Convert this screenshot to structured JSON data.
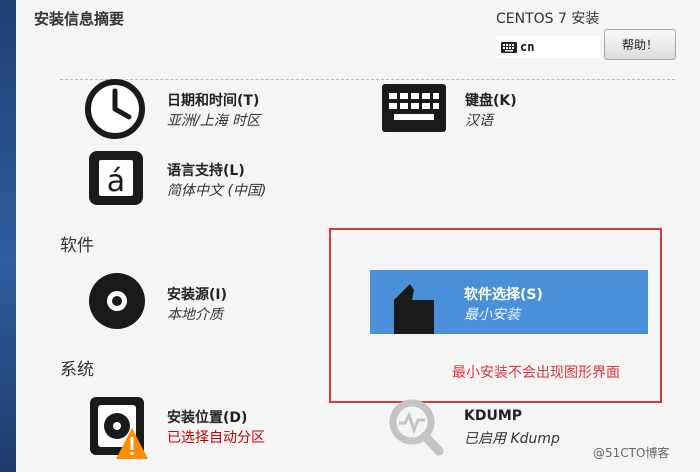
{
  "header": {
    "title": "安装信息摘要",
    "product": "CENTOS 7 安装",
    "keyboard_layout": "cn",
    "help_label": "帮助！"
  },
  "sections": {
    "software": "软件",
    "system": "系统"
  },
  "spokes": {
    "datetime": {
      "name": "日期和时间(T)",
      "status": "亚洲/上海 时区",
      "icon": "clock-icon"
    },
    "keyboard": {
      "name": "键盘(K)",
      "status": "汉语",
      "icon": "keyboard-icon"
    },
    "language": {
      "name": "语言支持(L)",
      "status": "简体中文 (中国)",
      "icon": "language-icon",
      "glyph": "á"
    },
    "source": {
      "name": "安装源(I)",
      "status": "本地介质",
      "icon": "disc-icon"
    },
    "software_selection": {
      "name": "软件选择(S)",
      "status": "最小安装",
      "icon": "package-icon"
    },
    "destination": {
      "name": "安装位置(D)",
      "status": "已选择自动分区",
      "icon": "harddisk-icon"
    },
    "kdump": {
      "name": "KDUMP",
      "status": "已启用 Kdump",
      "icon": "search-icon"
    }
  },
  "annotation": {
    "text": "最小安装不会出现图形界面"
  },
  "watermark": "@51CTO博客",
  "colors": {
    "selected_tile": "#4a90d9",
    "annotation_red": "#e0353b",
    "warning_text": "#cc0000",
    "warning_triangle": "#ff8c00"
  }
}
